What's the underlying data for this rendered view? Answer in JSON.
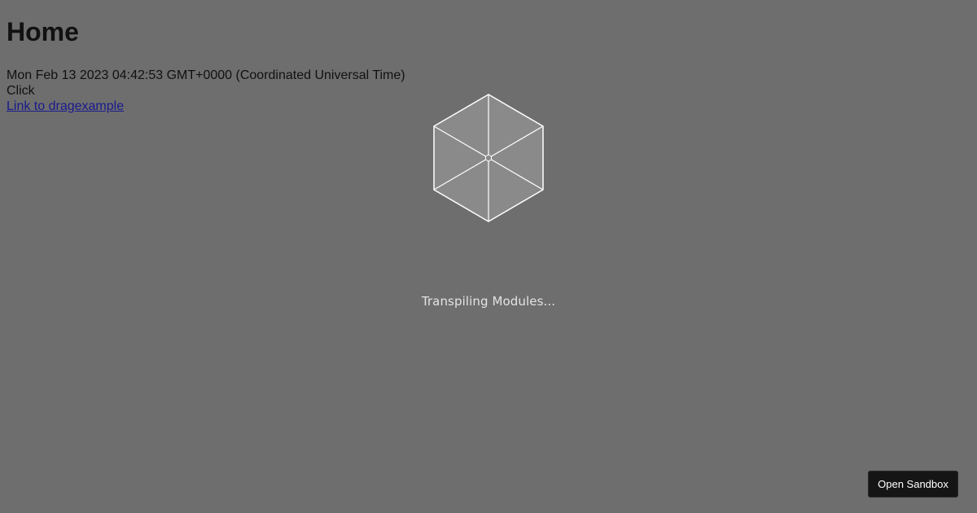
{
  "page": {
    "title": "Home",
    "timestamp": "Mon Feb 13 2023 04:42:53 GMT+0000 (Coordinated Universal Time)",
    "click_text": "Click",
    "link_text": "Link to dragexample"
  },
  "loader": {
    "icon": "codesandbox-cube-icon",
    "status_text": "Transpiling Modules..."
  },
  "sandbox": {
    "button_label": "Open Sandbox"
  },
  "colors": {
    "background": "#6e6e6e",
    "loader_fill": "#8a8a8a",
    "loader_stroke": "#ffffff",
    "link": "#1a1a8c",
    "button_bg": "#151515",
    "status_text": "#e3e3e3"
  }
}
